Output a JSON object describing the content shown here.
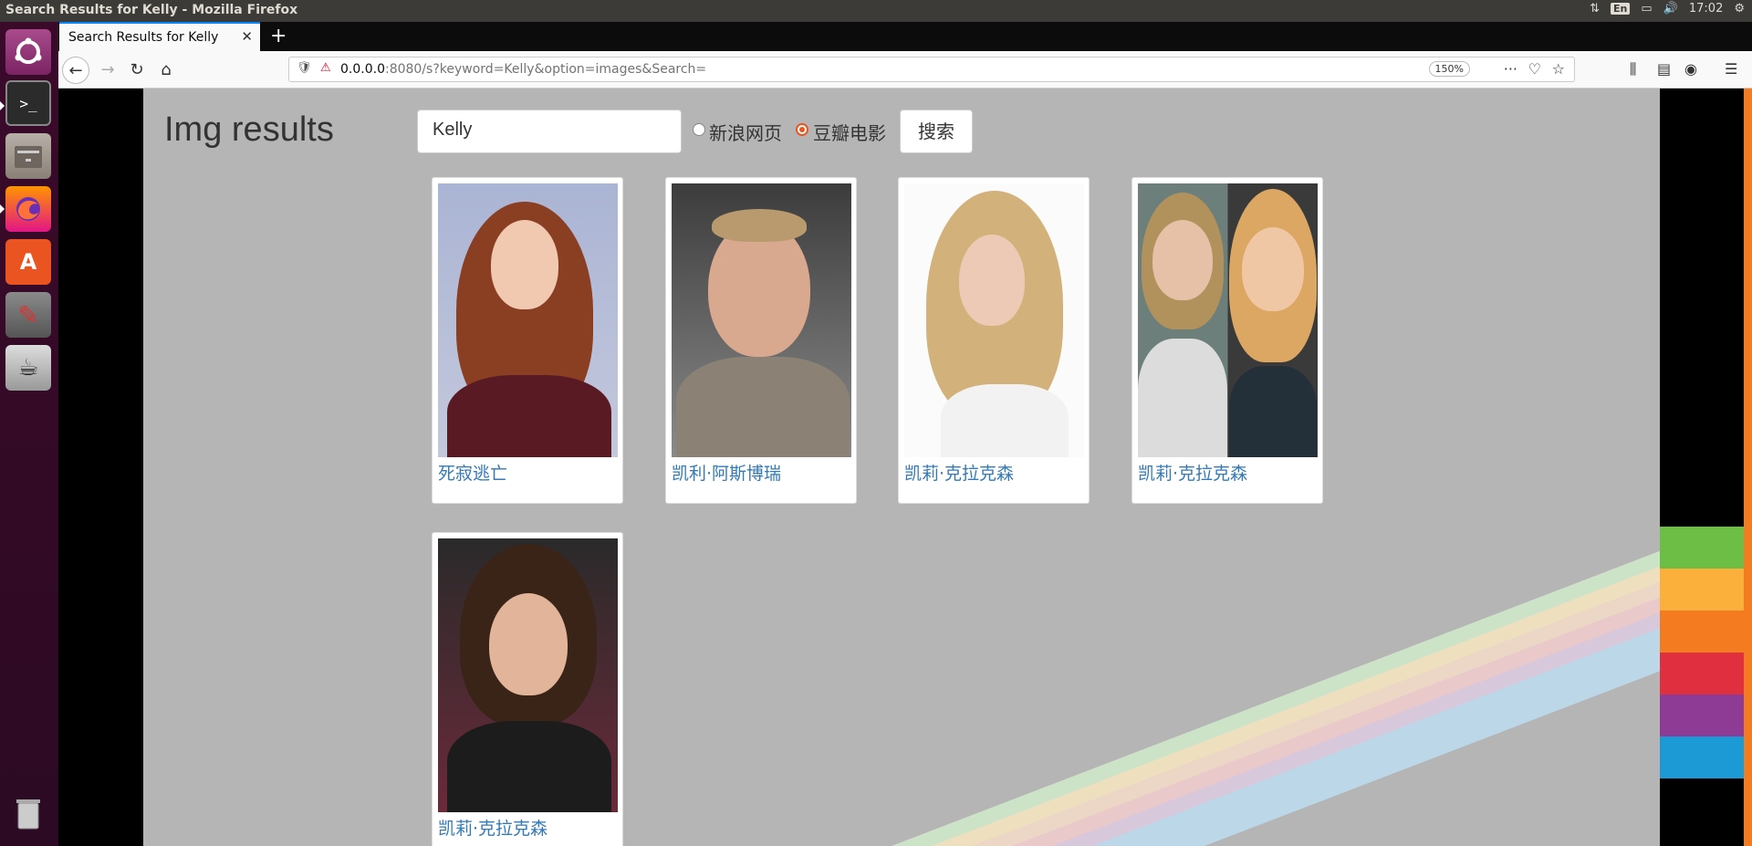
{
  "window": {
    "title": "Search Results for Kelly - Mozilla Firefox",
    "time": "17:02",
    "lang": "En"
  },
  "browser": {
    "tab_title": "Search Results for Kelly",
    "url_host": "0.0.0.0",
    "url_rest": ":8080/s?keyword=Kelly&option=images&Search=",
    "zoom": "150%"
  },
  "page": {
    "heading": "Img results",
    "search": {
      "value": "Kelly",
      "options": [
        {
          "label": "新浪网页",
          "checked": false
        },
        {
          "label": "豆瓣电影",
          "checked": true
        }
      ],
      "button": "搜索"
    },
    "results": [
      {
        "caption": "死寂逃亡"
      },
      {
        "caption": "凯利·阿斯博瑞"
      },
      {
        "caption": "凯莉·克拉克森"
      },
      {
        "caption": "凯莉·克拉克森"
      },
      {
        "caption": "凯莉·克拉克森"
      }
    ]
  }
}
